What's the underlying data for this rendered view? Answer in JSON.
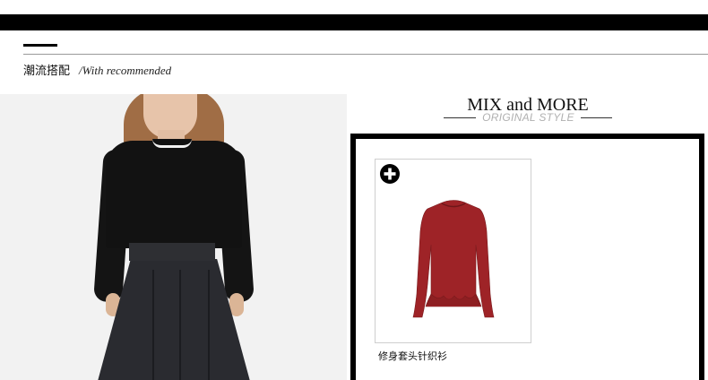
{
  "section": {
    "heading_cn": "潮流搭配",
    "heading_en": "/With recommended"
  },
  "mix": {
    "title": "MIX and MORE",
    "subtitle": "ORIGINAL STYLE"
  },
  "products": [
    {
      "name": "修身套头针织衫",
      "color": "#9e2327",
      "icon": "plus-circle-icon"
    }
  ],
  "colors": {
    "top_bar": "#000000",
    "frame": "#000000",
    "subtitle": "#b0b0b0"
  }
}
